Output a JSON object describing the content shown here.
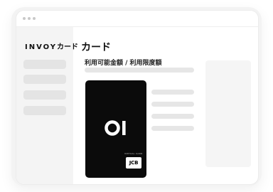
{
  "sidebar": {
    "logo": "INVOY",
    "logo_suffix": "カード",
    "items": [
      "",
      "",
      "",
      ""
    ]
  },
  "main": {
    "title": "カード",
    "subtitle": "利用可能金額 / 利用限度額"
  },
  "card": {
    "logo_icon": "card-logo-icon",
    "label": "VIRTUAL CARD",
    "brand": "JCB"
  },
  "colors": {
    "card_background": "#0b0b0b",
    "sidebar_background": "#f4f4f4",
    "placeholder_bar": "#e6e6e6"
  }
}
